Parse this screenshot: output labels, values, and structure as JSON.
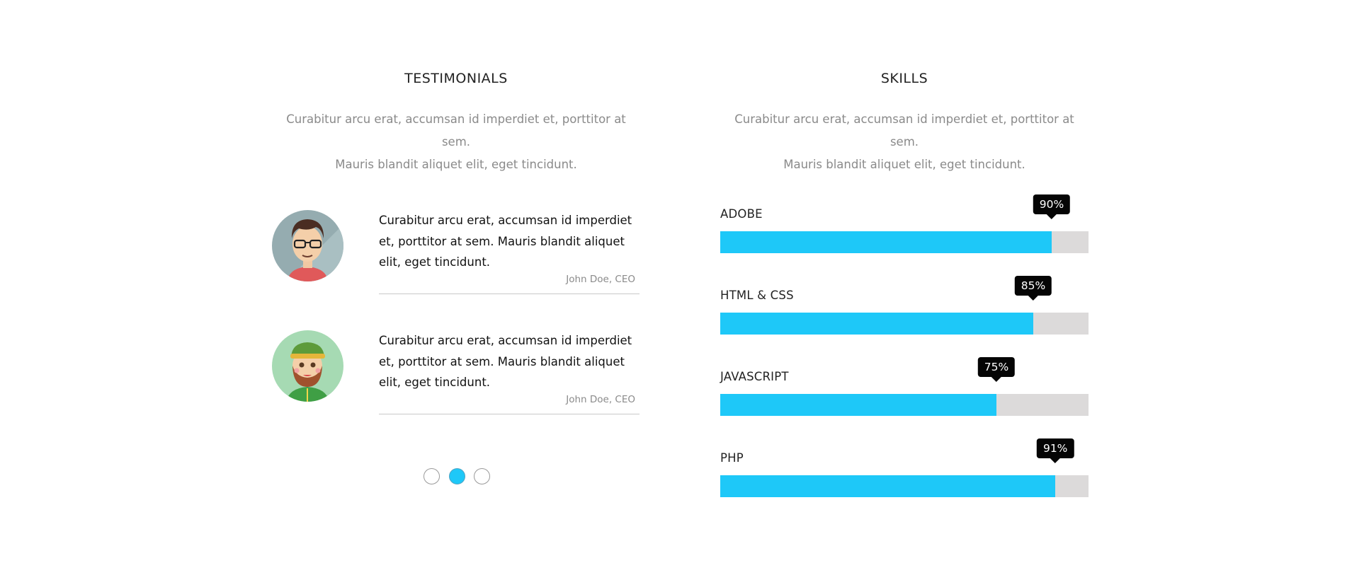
{
  "testimonials_section": {
    "title": "TESTIMONIALS",
    "subtitle_line1": "Curabitur arcu erat, accumsan id imperdiet et, porttitor at sem.",
    "subtitle_line2": "Mauris blandit aliquet elit, eget tincidunt.",
    "items": [
      {
        "quote": "Curabitur arcu erat, accumsan id imperdiet et, porttitor at sem. Mauris blandit aliquet elit, eget tincidunt.",
        "author": "John Doe, CEO",
        "avatar_icon": "man-glasses-avatar-icon"
      },
      {
        "quote": "Curabitur arcu erat, accumsan id imperdiet et, porttitor at sem. Mauris blandit aliquet elit, eget tincidunt.",
        "author": "John Doe, CEO",
        "avatar_icon": "bearded-man-avatar-icon"
      }
    ],
    "pagination": {
      "count": 3,
      "active_index": 1
    }
  },
  "skills_section": {
    "title": "SKILLS",
    "subtitle_line1": "Curabitur arcu erat, accumsan id imperdiet et, porttitor at sem.",
    "subtitle_line2": "Mauris blandit aliquet elit, eget tincidunt.",
    "skills": [
      {
        "label": "ADOBE",
        "percent_text": "90%",
        "value": 90
      },
      {
        "label": "HTML & CSS",
        "percent_text": "85%",
        "value": 85
      },
      {
        "label": "JAVASCRIPT",
        "percent_text": "75%",
        "value": 75
      },
      {
        "label": "PHP",
        "percent_text": "91%",
        "value": 91
      }
    ]
  },
  "colors": {
    "accent": "#1ec8f8",
    "track": "#dcdada",
    "bubble": "#050505",
    "muted_text": "#8a8a8a"
  }
}
